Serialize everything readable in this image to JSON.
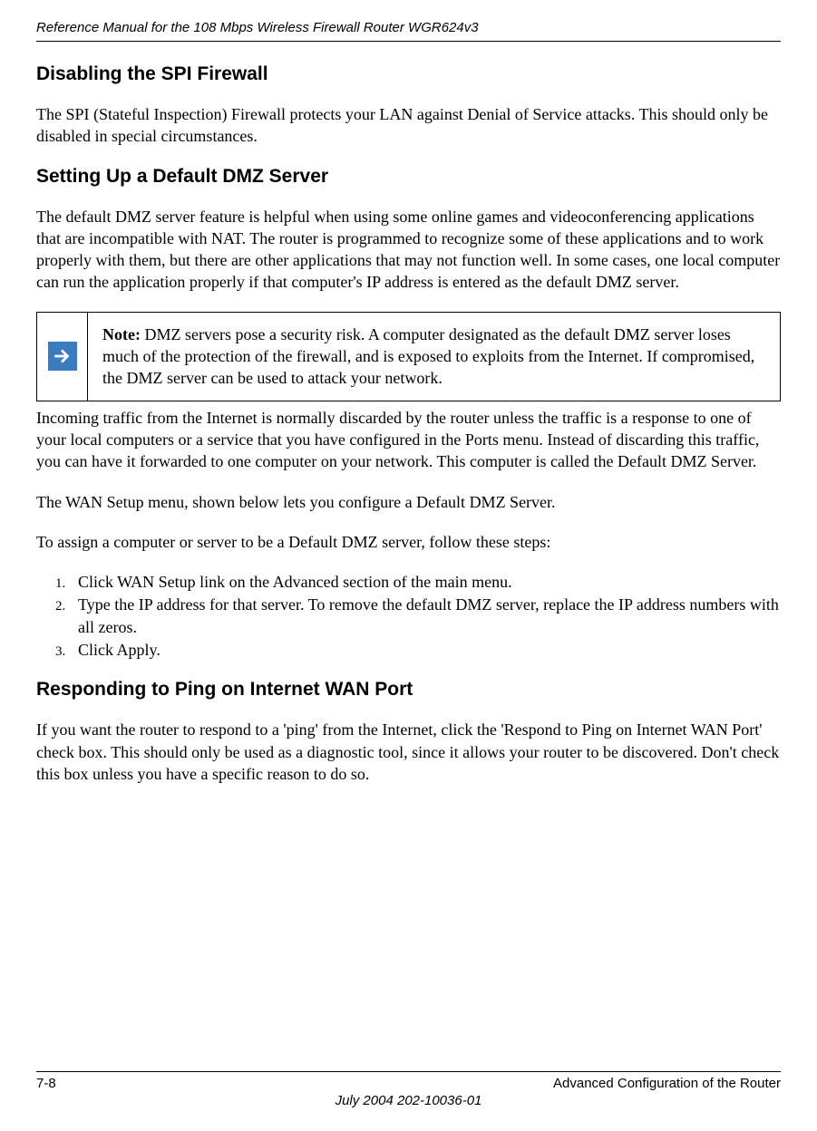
{
  "header": {
    "title": "Reference Manual for the 108 Mbps Wireless Firewall Router WGR624v3"
  },
  "sections": {
    "spi_firewall": {
      "heading": "Disabling the SPI Firewall",
      "para": "The SPI (Stateful Inspection) Firewall protects your LAN against Denial of Service attacks. This should only be disabled in special circumstances."
    },
    "dmz": {
      "heading": "Setting Up a Default DMZ Server",
      "para1": "The default DMZ server feature is helpful when using some online games and videoconferencing applications that are incompatible with NAT. The router is programmed to recognize some of these applications and to work properly with them, but there are other applications that may not function well. In some cases, one local computer can run the application properly if that computer's IP address is entered as the default DMZ server.",
      "note": {
        "label": "Note:",
        "text": " DMZ servers pose a security risk. A computer designated as the default DMZ server loses much of the protection of the firewall, and is exposed to exploits from the Internet. If compromised, the DMZ server can be used to attack your network."
      },
      "para2": "Incoming traffic from the Internet is normally discarded by the router unless the traffic is a response to one of your local computers or a service that you have configured in the Ports menu. Instead of discarding this traffic, you can have it forwarded to one computer on your network. This computer is called the Default DMZ Server.",
      "para3": "The WAN Setup menu, shown below lets you configure a Default DMZ Server.",
      "para4": "To assign a computer or server to be a Default DMZ server, follow these steps:",
      "steps": [
        "Click WAN Setup link on the Advanced section of the main menu.",
        "Type the IP address for that server. To remove the default DMZ server, replace the IP address numbers with all zeros.",
        "Click Apply."
      ]
    },
    "ping": {
      "heading": "Responding to Ping on Internet WAN Port",
      "para": "If you want the router to respond to a 'ping' from the Internet, click the 'Respond to Ping on Internet WAN Port' check box. This should only be used as a diagnostic tool, since it allows your router to be discovered. Don't check this box unless you have a specific reason to do so."
    }
  },
  "footer": {
    "page": "7-8",
    "chapter": "Advanced Configuration of the Router",
    "date": "July 2004 202-10036-01"
  }
}
